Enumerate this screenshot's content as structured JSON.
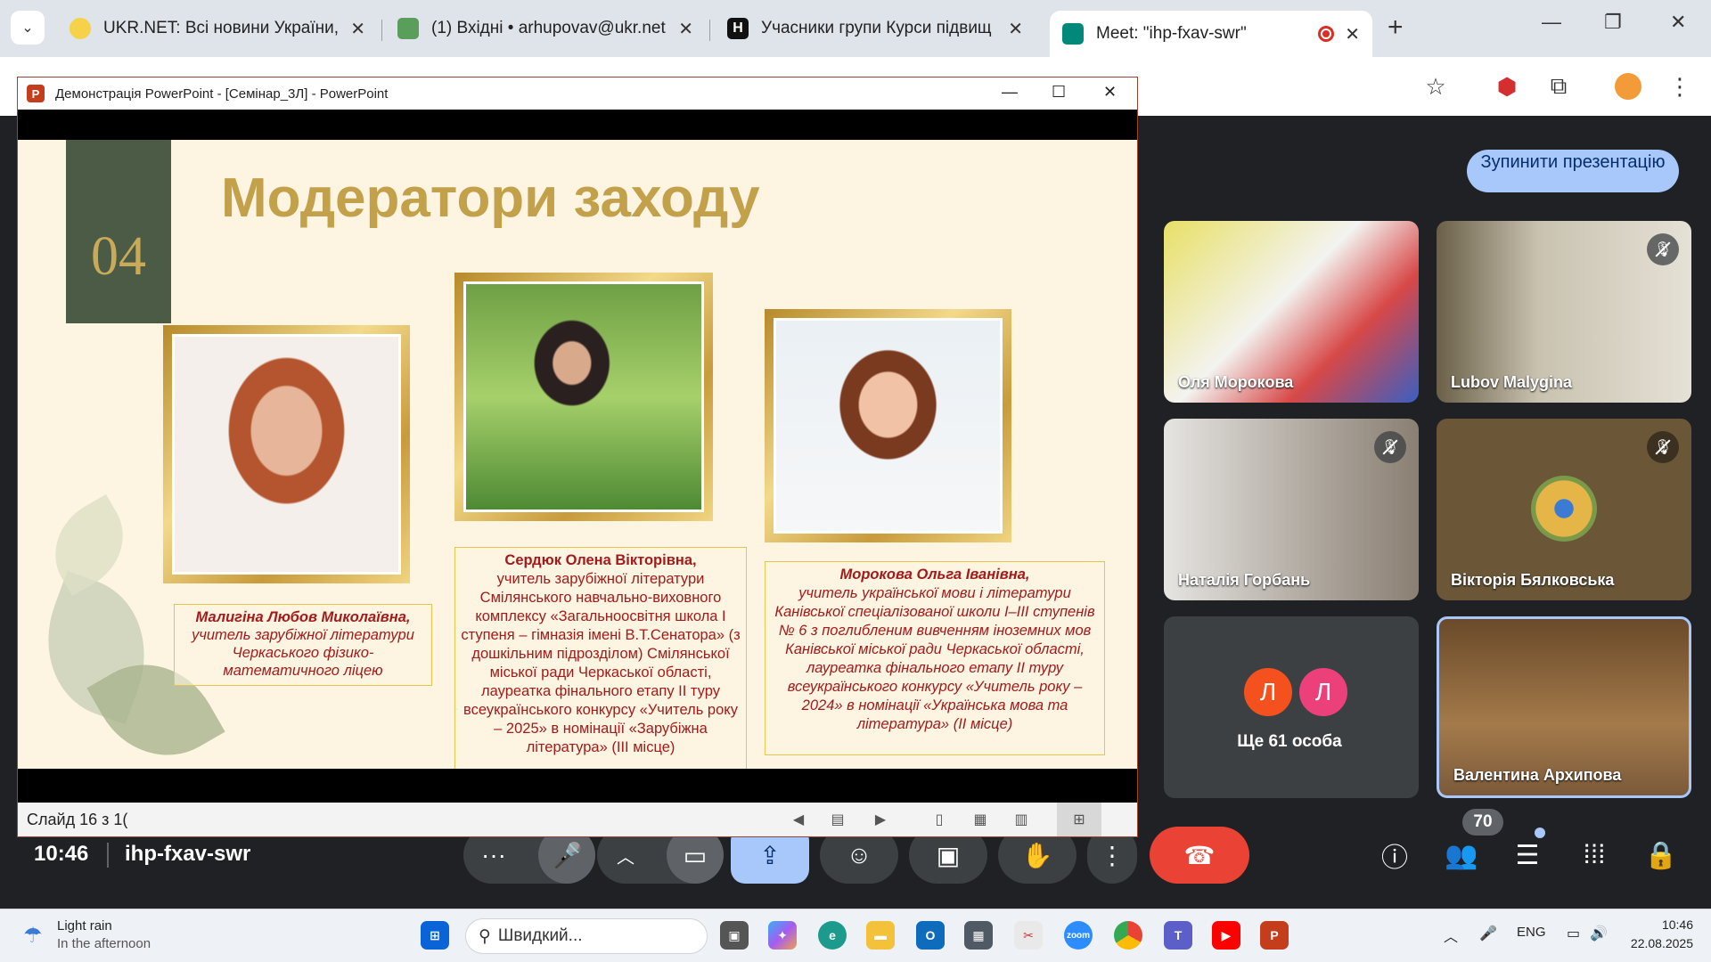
{
  "browser": {
    "tabs": [
      {
        "title": "UKR.NET: Всі новини України, с",
        "favicon_color": "#f6d24a"
      },
      {
        "title": "(1) Вхідні • arhupovav@ukr.net",
        "favicon_color": "#5a9e5b"
      },
      {
        "title": "Учасники групи Курси підвищ",
        "favicon_color": "#111111"
      },
      {
        "title": "Meet: \"ihp-fxav-swr\"",
        "favicon_color": "#00897b"
      }
    ],
    "new_tab": "+",
    "window": {
      "minimize": "—",
      "restore": "❐",
      "close": "✕"
    }
  },
  "powerpoint": {
    "window_title": "Демонстрація PowerPoint - [Семінар_3Л] - PowerPoint",
    "logo": "P",
    "slide": {
      "number": "04",
      "title": "Модератори заходу",
      "moderators": [
        {
          "name": "Малигіна Любов Миколаївна,",
          "text": "учитель зарубіжної літератури Черкаського фізико-математичного ліцею"
        },
        {
          "name": "Сердюк Олена Вікторівна,",
          "text": "учитель зарубіжної літератури Смілянського навчально-виховного комплексу «Загальноосвітня школа І ступеня – гімназія імені В.Т.Сенатора» (з дошкільним підрозділом) Смілянської міської ради Черкаської області, лауреатка фінального етапу ІІ туру всеукраїнського конкурсу «Учитель року – 2025» в номінації «Зарубіжна література» (ІІІ місце)"
        },
        {
          "name": "Морокова Ольга Іванівна,",
          "text": "учитель української мови і літератури Канівської спеціалізованої школи І–ІІІ ступенів № 6 з поглибленим вивченням іноземних мов Канівської міської ради Черкаської області, лауреатка фінального етапу ІІ туру всеукраїнського конкурсу «Учитель року – 2024» в номінації «Українська мова та література» (ІІ місце)"
        }
      ]
    },
    "status": "Слайд 16 з 1("
  },
  "meet": {
    "stop_presenting": "Зупинити презентацію",
    "participants": [
      {
        "name": "Оля Морокова",
        "muted": false
      },
      {
        "name": "Lubov Malygina",
        "muted": true
      },
      {
        "name": "Наталія Горбань",
        "muted": true
      },
      {
        "name": "Вікторія Бялковська",
        "muted": true
      },
      {
        "name": "Валентина Архипова",
        "muted": false
      }
    ],
    "more": {
      "avatars": [
        "Л",
        "Л"
      ],
      "label": "Ще 61 особа"
    },
    "time": "10:46",
    "code": "ihp-fxav-swr",
    "participant_count": "70"
  },
  "taskbar": {
    "weather": {
      "line1": "Light rain",
      "line2": "In the afternoon"
    },
    "search_placeholder": "Швидкий...",
    "language": "ENG",
    "time": "10:46",
    "date": "22.08.2025"
  }
}
